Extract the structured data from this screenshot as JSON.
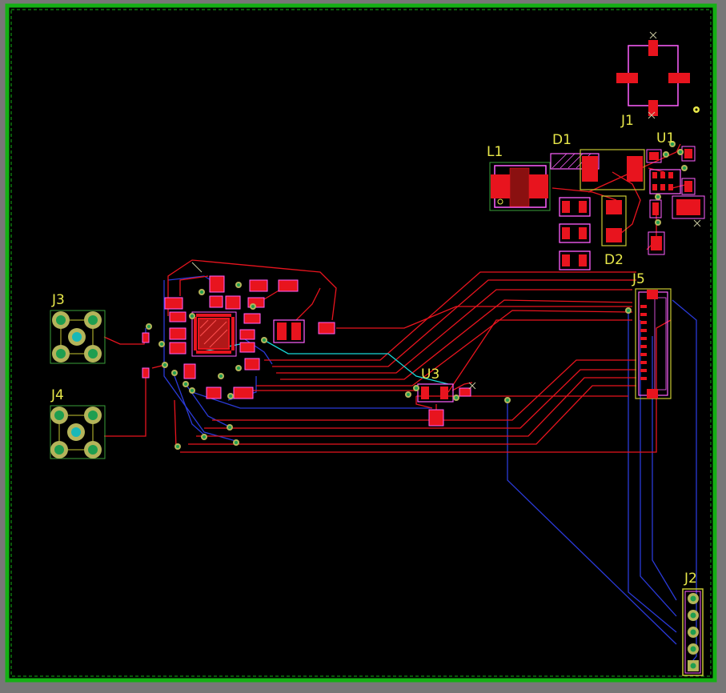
{
  "canvas": {
    "background": "#777777",
    "board_fill": "#000000",
    "edge_color": "#14b014",
    "colors": {
      "front_copper": "#e8141e",
      "back_copper": "#2a3ad8",
      "silkscreen": "#e8e84a",
      "courtyard": "#ff40ff",
      "inner": "#18d8d8",
      "via_ring": "#b4b45a",
      "via_hole": "#1e9e50"
    }
  },
  "components": [
    {
      "ref": "J1",
      "label": "J1"
    },
    {
      "ref": "U1",
      "label": "U1"
    },
    {
      "ref": "L1",
      "label": "L1"
    },
    {
      "ref": "D1",
      "label": "D1"
    },
    {
      "ref": "D2",
      "label": "D2"
    },
    {
      "ref": "J5",
      "label": "J5"
    },
    {
      "ref": "J3",
      "label": "J3"
    },
    {
      "ref": "J4",
      "label": "J4"
    },
    {
      "ref": "U3",
      "label": "U3"
    },
    {
      "ref": "J2",
      "label": "J2"
    }
  ]
}
